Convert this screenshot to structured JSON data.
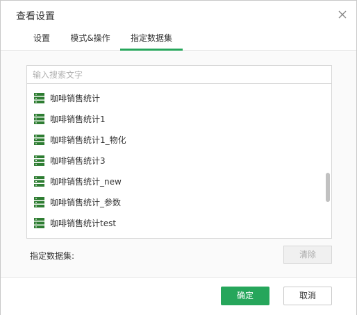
{
  "dialog": {
    "title": "查看设置"
  },
  "tabs": [
    {
      "label": "设置",
      "active": false
    },
    {
      "label": "模式&操作",
      "active": false
    },
    {
      "label": "指定数据集",
      "active": true
    }
  ],
  "search": {
    "placeholder": "输入搜索文字"
  },
  "datasets": [
    {
      "label": "咖啡销售统计",
      "icon": "dataset-icon"
    },
    {
      "label": "咖啡销售统计1",
      "icon": "dataset-icon"
    },
    {
      "label": "咖啡销售统计1_物化",
      "icon": "dataset-icon"
    },
    {
      "label": "咖啡销售统计3",
      "icon": "dataset-icon"
    },
    {
      "label": "咖啡销售统计_new",
      "icon": "dataset-icon"
    },
    {
      "label": "咖啡销售统计_参数",
      "icon": "dataset-icon"
    },
    {
      "label": "咖啡销售统计test",
      "icon": "dataset-icon"
    }
  ],
  "selection": {
    "label": "指定数据集:",
    "clear_label": "清除"
  },
  "footer": {
    "ok_label": "确定",
    "cancel_label": "取消"
  },
  "colors": {
    "accent": "#26a65b",
    "icon": "#2e7d32"
  }
}
